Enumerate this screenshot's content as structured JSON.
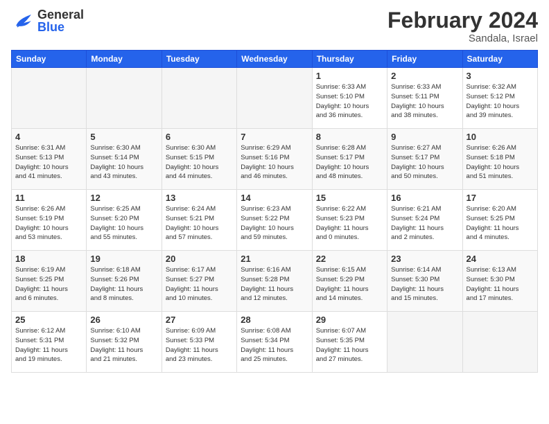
{
  "header": {
    "logo": {
      "general": "General",
      "blue": "Blue"
    },
    "title": "February 2024",
    "location": "Sandala, Israel"
  },
  "weekdays": [
    "Sunday",
    "Monday",
    "Tuesday",
    "Wednesday",
    "Thursday",
    "Friday",
    "Saturday"
  ],
  "weeks": [
    [
      {
        "day": "",
        "info": ""
      },
      {
        "day": "",
        "info": ""
      },
      {
        "day": "",
        "info": ""
      },
      {
        "day": "",
        "info": ""
      },
      {
        "day": "1",
        "info": "Sunrise: 6:33 AM\nSunset: 5:10 PM\nDaylight: 10 hours\nand 36 minutes."
      },
      {
        "day": "2",
        "info": "Sunrise: 6:33 AM\nSunset: 5:11 PM\nDaylight: 10 hours\nand 38 minutes."
      },
      {
        "day": "3",
        "info": "Sunrise: 6:32 AM\nSunset: 5:12 PM\nDaylight: 10 hours\nand 39 minutes."
      }
    ],
    [
      {
        "day": "4",
        "info": "Sunrise: 6:31 AM\nSunset: 5:13 PM\nDaylight: 10 hours\nand 41 minutes."
      },
      {
        "day": "5",
        "info": "Sunrise: 6:30 AM\nSunset: 5:14 PM\nDaylight: 10 hours\nand 43 minutes."
      },
      {
        "day": "6",
        "info": "Sunrise: 6:30 AM\nSunset: 5:15 PM\nDaylight: 10 hours\nand 44 minutes."
      },
      {
        "day": "7",
        "info": "Sunrise: 6:29 AM\nSunset: 5:16 PM\nDaylight: 10 hours\nand 46 minutes."
      },
      {
        "day": "8",
        "info": "Sunrise: 6:28 AM\nSunset: 5:17 PM\nDaylight: 10 hours\nand 48 minutes."
      },
      {
        "day": "9",
        "info": "Sunrise: 6:27 AM\nSunset: 5:17 PM\nDaylight: 10 hours\nand 50 minutes."
      },
      {
        "day": "10",
        "info": "Sunrise: 6:26 AM\nSunset: 5:18 PM\nDaylight: 10 hours\nand 51 minutes."
      }
    ],
    [
      {
        "day": "11",
        "info": "Sunrise: 6:26 AM\nSunset: 5:19 PM\nDaylight: 10 hours\nand 53 minutes."
      },
      {
        "day": "12",
        "info": "Sunrise: 6:25 AM\nSunset: 5:20 PM\nDaylight: 10 hours\nand 55 minutes."
      },
      {
        "day": "13",
        "info": "Sunrise: 6:24 AM\nSunset: 5:21 PM\nDaylight: 10 hours\nand 57 minutes."
      },
      {
        "day": "14",
        "info": "Sunrise: 6:23 AM\nSunset: 5:22 PM\nDaylight: 10 hours\nand 59 minutes."
      },
      {
        "day": "15",
        "info": "Sunrise: 6:22 AM\nSunset: 5:23 PM\nDaylight: 11 hours\nand 0 minutes."
      },
      {
        "day": "16",
        "info": "Sunrise: 6:21 AM\nSunset: 5:24 PM\nDaylight: 11 hours\nand 2 minutes."
      },
      {
        "day": "17",
        "info": "Sunrise: 6:20 AM\nSunset: 5:25 PM\nDaylight: 11 hours\nand 4 minutes."
      }
    ],
    [
      {
        "day": "18",
        "info": "Sunrise: 6:19 AM\nSunset: 5:25 PM\nDaylight: 11 hours\nand 6 minutes."
      },
      {
        "day": "19",
        "info": "Sunrise: 6:18 AM\nSunset: 5:26 PM\nDaylight: 11 hours\nand 8 minutes."
      },
      {
        "day": "20",
        "info": "Sunrise: 6:17 AM\nSunset: 5:27 PM\nDaylight: 11 hours\nand 10 minutes."
      },
      {
        "day": "21",
        "info": "Sunrise: 6:16 AM\nSunset: 5:28 PM\nDaylight: 11 hours\nand 12 minutes."
      },
      {
        "day": "22",
        "info": "Sunrise: 6:15 AM\nSunset: 5:29 PM\nDaylight: 11 hours\nand 14 minutes."
      },
      {
        "day": "23",
        "info": "Sunrise: 6:14 AM\nSunset: 5:30 PM\nDaylight: 11 hours\nand 15 minutes."
      },
      {
        "day": "24",
        "info": "Sunrise: 6:13 AM\nSunset: 5:30 PM\nDaylight: 11 hours\nand 17 minutes."
      }
    ],
    [
      {
        "day": "25",
        "info": "Sunrise: 6:12 AM\nSunset: 5:31 PM\nDaylight: 11 hours\nand 19 minutes."
      },
      {
        "day": "26",
        "info": "Sunrise: 6:10 AM\nSunset: 5:32 PM\nDaylight: 11 hours\nand 21 minutes."
      },
      {
        "day": "27",
        "info": "Sunrise: 6:09 AM\nSunset: 5:33 PM\nDaylight: 11 hours\nand 23 minutes."
      },
      {
        "day": "28",
        "info": "Sunrise: 6:08 AM\nSunset: 5:34 PM\nDaylight: 11 hours\nand 25 minutes."
      },
      {
        "day": "29",
        "info": "Sunrise: 6:07 AM\nSunset: 5:35 PM\nDaylight: 11 hours\nand 27 minutes."
      },
      {
        "day": "",
        "info": ""
      },
      {
        "day": "",
        "info": ""
      }
    ]
  ]
}
